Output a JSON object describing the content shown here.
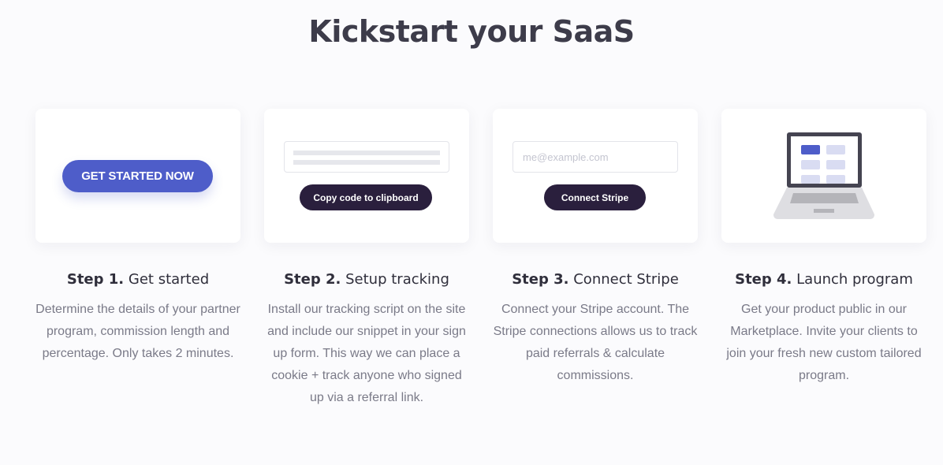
{
  "header": {
    "title": "Kickstart your SaaS"
  },
  "steps": [
    {
      "number": "Step 1.",
      "title": "Get started",
      "description": "Determine the details of your partner program, commission length and percentage. Only takes 2 minutes.",
      "cta_label": "GET STARTED NOW"
    },
    {
      "number": "Step 2.",
      "title": "Setup tracking",
      "description": "Install our tracking script on the site and include our snippet in your sign up form. This way we can place a cookie + track anyone who signed up via a referral link.",
      "cta_label": "Copy code to clipboard"
    },
    {
      "number": "Step 3.",
      "title": "Connect Stripe",
      "description": "Connect your Stripe account. The Stripe connections allows us to track paid referrals & calculate commissions.",
      "email_placeholder": "me@example.com",
      "cta_label": "Connect Stripe"
    },
    {
      "number": "Step 4.",
      "title": "Launch program",
      "description": "Get your product public in our Marketplace. Invite your clients to join your fresh new custom tailored program."
    }
  ],
  "colors": {
    "primary": "#4e5dc9",
    "dark_button": "#2a1f3d",
    "heading": "#3d3c4a",
    "muted_text": "#7a7a88"
  },
  "icons": [
    "laptop-icon"
  ]
}
